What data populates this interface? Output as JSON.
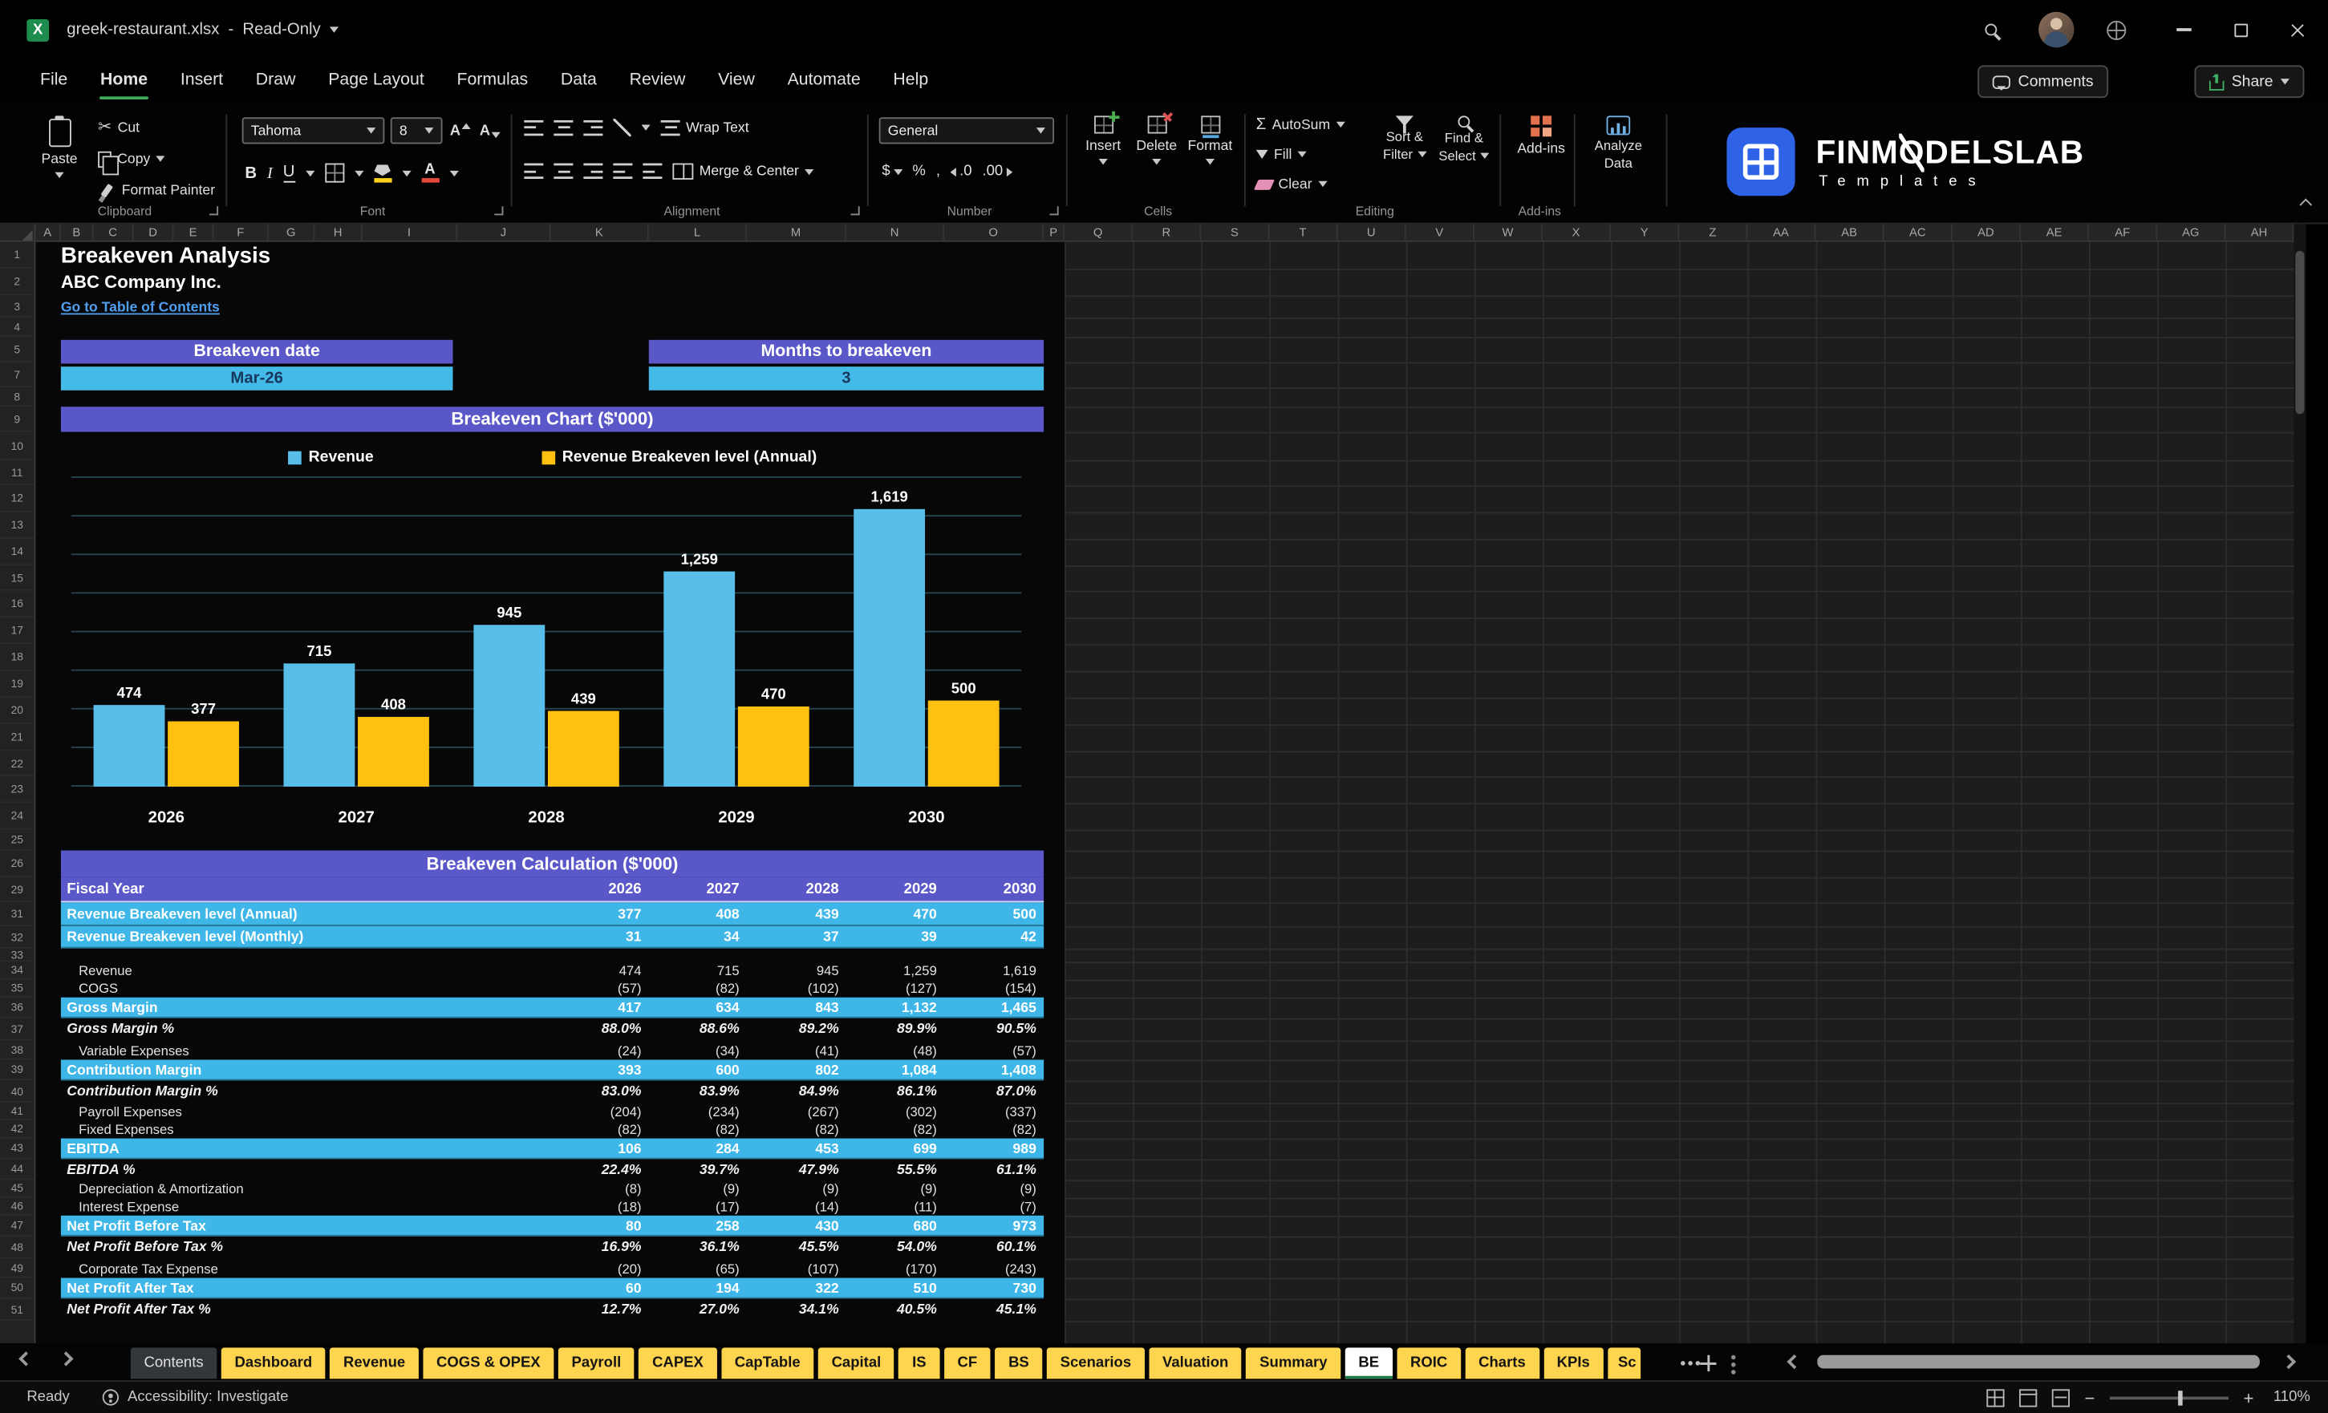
{
  "titlebar": {
    "filename": "greek-restaurant.xlsx",
    "dash": "-",
    "mode": "Read-Only"
  },
  "menu": {
    "tabs": [
      "File",
      "Home",
      "Insert",
      "Draw",
      "Page Layout",
      "Formulas",
      "Data",
      "Review",
      "View",
      "Automate",
      "Help"
    ],
    "active": "Home",
    "comments": "Comments",
    "share": "Share"
  },
  "ribbon": {
    "clipboard": {
      "group": "Clipboard",
      "paste": "Paste",
      "cut": "Cut",
      "copy": "Copy",
      "format_painter": "Format Painter"
    },
    "font": {
      "group": "Font",
      "name": "Tahoma",
      "size": "8",
      "bold": "B",
      "italic": "I",
      "underline": "U",
      "grow": "A",
      "shrink": "A",
      "color_a": "A"
    },
    "alignment": {
      "group": "Alignment",
      "wrap": "Wrap Text",
      "merge": "Merge & Center"
    },
    "number": {
      "group": "Number",
      "format": "General",
      "currency": "$",
      "percent": "%",
      "comma": ",",
      "dec_inc": ".0",
      "dec_dec": ".00"
    },
    "cells": {
      "group": "Cells",
      "insert": "Insert",
      "delete": "Delete",
      "format": "Format"
    },
    "editing": {
      "group": "Editing",
      "sigma": "Σ",
      "autosum": "AutoSum",
      "fill": "Fill",
      "clear": "Clear",
      "sort1": "Sort &",
      "sort2": "Filter",
      "find1": "Find &",
      "find2": "Select"
    },
    "addins": {
      "group": "Add-ins",
      "addins": "Add-ins",
      "analyze1": "Analyze",
      "analyze2": "Data"
    },
    "logo": {
      "p1": "FINM",
      "o": "O",
      "p2": "DELSLAB",
      "sub": "Templates"
    }
  },
  "sheet": {
    "title": "Breakeven Analysis",
    "company": "ABC Company Inc.",
    "link": "Go to Table of Contents",
    "date_label": "Breakeven date",
    "date_value": "Mar-26",
    "months_label": "Months to breakeven",
    "months_value": "3"
  },
  "chart_data": {
    "type": "bar",
    "title": "Breakeven Chart ($'000)",
    "categories": [
      "2026",
      "2027",
      "2028",
      "2029",
      "2030"
    ],
    "series": [
      {
        "name": "Revenue",
        "color": "#58BDE8",
        "values": [
          474,
          715,
          945,
          1259,
          1619
        ],
        "labels": [
          "474",
          "715",
          "945",
          "1,259",
          "1,619"
        ]
      },
      {
        "name": "Revenue Breakeven level (Annual)",
        "color": "#FFC010",
        "values": [
          377,
          408,
          439,
          470,
          500
        ],
        "labels": [
          "377",
          "408",
          "439",
          "470",
          "500"
        ]
      }
    ],
    "xlabel": "",
    "ylabel": "",
    "ylim": [
      0,
      1800
    ],
    "gridlines": true,
    "legend_position": "top"
  },
  "table": {
    "title": "Breakeven Calculation ($'000)",
    "header": [
      "Fiscal Year",
      "2026",
      "2027",
      "2028",
      "2029",
      "2030"
    ],
    "rows": [
      {
        "label": "Revenue Breakeven level (Annual)",
        "values": [
          "377",
          "408",
          "439",
          "470",
          "500"
        ],
        "style": "highlight"
      },
      {
        "label": "Revenue Breakeven level (Monthly)",
        "values": [
          "31",
          "34",
          "37",
          "39",
          "42"
        ],
        "style": "highlight"
      },
      {
        "label": "",
        "values": [
          "",
          "",
          "",
          "",
          ""
        ],
        "style": "spacer"
      },
      {
        "label": "Revenue",
        "values": [
          "474",
          "715",
          "945",
          "1,259",
          "1,619"
        ],
        "style": "plain",
        "indent": true
      },
      {
        "label": "COGS",
        "values": [
          "(57)",
          "(82)",
          "(102)",
          "(127)",
          "(154)"
        ],
        "style": "plain",
        "indent": true
      },
      {
        "label": "Gross Margin",
        "values": [
          "417",
          "634",
          "843",
          "1,132",
          "1,465"
        ],
        "style": "highlight"
      },
      {
        "label": "Gross Margin %",
        "values": [
          "88.0%",
          "88.6%",
          "89.2%",
          "89.9%",
          "90.5%"
        ],
        "style": "percent"
      },
      {
        "label": "Variable Expenses",
        "values": [
          "(24)",
          "(34)",
          "(41)",
          "(48)",
          "(57)"
        ],
        "style": "plain",
        "indent": true
      },
      {
        "label": "Contribution Margin",
        "values": [
          "393",
          "600",
          "802",
          "1,084",
          "1,408"
        ],
        "style": "highlight"
      },
      {
        "label": "Contribution Margin %",
        "values": [
          "83.0%",
          "83.9%",
          "84.9%",
          "86.1%",
          "87.0%"
        ],
        "style": "percent"
      },
      {
        "label": "Payroll Expenses",
        "values": [
          "(204)",
          "(234)",
          "(267)",
          "(302)",
          "(337)"
        ],
        "style": "plain",
        "indent": true
      },
      {
        "label": "Fixed Expenses",
        "values": [
          "(82)",
          "(82)",
          "(82)",
          "(82)",
          "(82)"
        ],
        "style": "plain",
        "indent": true
      },
      {
        "label": "EBITDA",
        "values": [
          "106",
          "284",
          "453",
          "699",
          "989"
        ],
        "style": "highlight"
      },
      {
        "label": "EBITDA %",
        "values": [
          "22.4%",
          "39.7%",
          "47.9%",
          "55.5%",
          "61.1%"
        ],
        "style": "percent"
      },
      {
        "label": "Depreciation & Amortization",
        "values": [
          "(8)",
          "(9)",
          "(9)",
          "(9)",
          "(9)"
        ],
        "style": "plain",
        "indent": true
      },
      {
        "label": "Interest Expense",
        "values": [
          "(18)",
          "(17)",
          "(14)",
          "(11)",
          "(7)"
        ],
        "style": "plain",
        "indent": true
      },
      {
        "label": "Net Profit Before Tax",
        "values": [
          "80",
          "258",
          "430",
          "680",
          "973"
        ],
        "style": "highlight"
      },
      {
        "label": "Net Profit Before Tax %",
        "values": [
          "16.9%",
          "36.1%",
          "45.5%",
          "54.0%",
          "60.1%"
        ],
        "style": "percent"
      },
      {
        "label": "Corporate Tax Expense",
        "values": [
          "(20)",
          "(65)",
          "(107)",
          "(170)",
          "(243)"
        ],
        "style": "plain",
        "indent": true
      },
      {
        "label": "Net Profit After Tax",
        "values": [
          "60",
          "194",
          "322",
          "510",
          "730"
        ],
        "style": "highlight"
      },
      {
        "label": "Net Profit After Tax %",
        "values": [
          "12.7%",
          "27.0%",
          "34.1%",
          "40.5%",
          "45.1%"
        ],
        "style": "percent"
      }
    ]
  },
  "grid": {
    "columns": [
      "A",
      "B",
      "C",
      "D",
      "E",
      "F",
      "G",
      "H",
      "I",
      "J",
      "K",
      "L",
      "M",
      "N",
      "O",
      "P",
      "Q",
      "R",
      "S",
      "T",
      "U",
      "V",
      "W",
      "X",
      "Y",
      "Z",
      "AA",
      "AB",
      "AC",
      "AD",
      "AE",
      "AF",
      "AG",
      "AH"
    ],
    "rows": [
      1,
      2,
      3,
      4,
      5,
      7,
      8,
      9,
      10,
      11,
      12,
      13,
      14,
      15,
      16,
      17,
      18,
      19,
      20,
      21,
      22,
      23,
      24,
      25,
      26,
      29,
      31,
      32,
      33,
      34,
      35,
      36,
      37,
      38,
      39,
      40,
      41,
      42,
      43,
      44,
      45,
      46,
      47,
      48,
      49,
      50,
      51
    ]
  },
  "sheet_tabs": {
    "items": [
      {
        "label": "Contents",
        "style": "gray"
      },
      {
        "label": "Dashboard",
        "style": "yellow"
      },
      {
        "label": "Revenue",
        "style": "yellow"
      },
      {
        "label": "COGS & OPEX",
        "style": "yellow"
      },
      {
        "label": "Payroll",
        "style": "yellow"
      },
      {
        "label": "CAPEX",
        "style": "yellow"
      },
      {
        "label": "CapTable",
        "style": "yellow"
      },
      {
        "label": "Capital",
        "style": "yellow"
      },
      {
        "label": "IS",
        "style": "yellow"
      },
      {
        "label": "CF",
        "style": "yellow"
      },
      {
        "label": "BS",
        "style": "yellow"
      },
      {
        "label": "Scenarios",
        "style": "yellow"
      },
      {
        "label": "Valuation",
        "style": "yellow"
      },
      {
        "label": "Summary",
        "style": "yellow"
      },
      {
        "label": "BE",
        "style": "active"
      },
      {
        "label": "ROIC",
        "style": "yellow"
      },
      {
        "label": "Charts",
        "style": "yellow"
      },
      {
        "label": "KPIs",
        "style": "yellow"
      },
      {
        "label": "Sc",
        "style": "yellow",
        "clipped": true
      }
    ]
  },
  "statusbar": {
    "ready": "Ready",
    "accessibility": "Accessibility: Investigate",
    "zoom": "110%",
    "zoom_out": "−",
    "zoom_in": "+"
  }
}
